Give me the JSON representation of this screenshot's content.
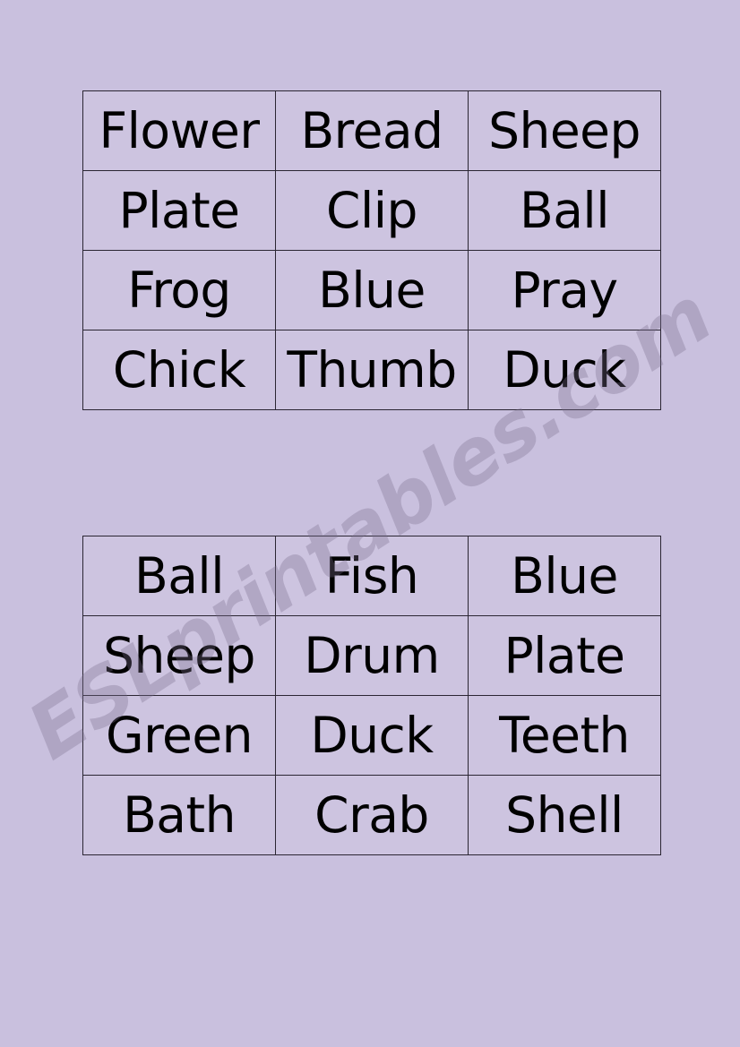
{
  "page": {
    "background_color": "#c9c0de",
    "cell_background_color": "#cdc4e0",
    "border_color": "#2b2633",
    "text_color": "#000000"
  },
  "watermark": {
    "text": "ESLprintables.com",
    "color": "#7a6e8c"
  },
  "cards": [
    {
      "name": "bingo-card-1",
      "rows": [
        [
          "Flower",
          "Bread",
          "Sheep"
        ],
        [
          "Plate",
          "Clip",
          "Ball"
        ],
        [
          "Frog",
          "Blue",
          "Pray"
        ],
        [
          "Chick",
          "Thumb",
          "Duck"
        ]
      ]
    },
    {
      "name": "bingo-card-2",
      "rows": [
        [
          "Ball",
          "Fish",
          "Blue"
        ],
        [
          "Sheep",
          "Drum",
          "Plate"
        ],
        [
          "Green",
          "Duck",
          "Teeth"
        ],
        [
          "Bath",
          "Crab",
          "Shell"
        ]
      ]
    }
  ]
}
